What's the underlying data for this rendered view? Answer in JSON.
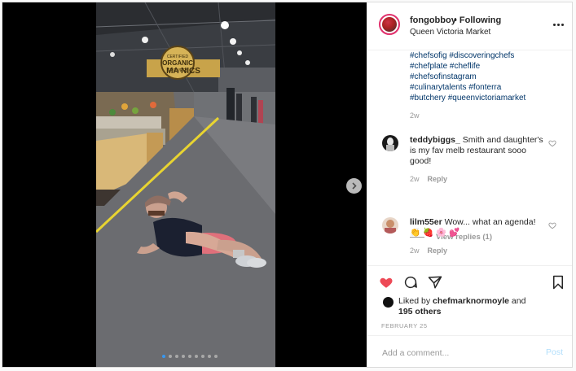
{
  "post": {
    "username": "fongobboy",
    "follow_status": "• Following",
    "location": "Queen Victoria Market",
    "carousel": {
      "total": 9,
      "active": 0
    },
    "photo_sign": {
      "line1": "CERTIFIED",
      "line2": "ORGANIC",
      "line3": "GROWERS",
      "wide": "MA      NICS"
    }
  },
  "caption": {
    "hashtags": [
      "#chefsofig #discoveringchefs",
      "#chefplate #cheflife",
      "#chefsofinstagram",
      "#culinarytalents #fonterra",
      "#butchery #queenvictoriamarket"
    ],
    "age": "2w"
  },
  "comments": [
    {
      "username": "teddybiggs_",
      "text": "Smith and daughter's is my fav melb restaurant sooo good!",
      "age": "2w",
      "reply": "Reply",
      "view_replies": "View replies (1)"
    },
    {
      "username": "lilm55er",
      "text": "Wow... what an agenda! 👏 🍓 🌸 💕",
      "age": "2w",
      "reply": "Reply"
    }
  ],
  "likes": {
    "prefix": "Liked by",
    "user": "chefmarknormoyle",
    "suffix": "and",
    "others": "195 others"
  },
  "date": "FEBRUARY 25",
  "add_comment": {
    "placeholder": "Add a comment...",
    "post_label": "Post"
  },
  "colors": {
    "like": "#ed4956",
    "link": "#003569",
    "post_disabled": "#b2dffc",
    "carousel_active": "#3897f0"
  }
}
